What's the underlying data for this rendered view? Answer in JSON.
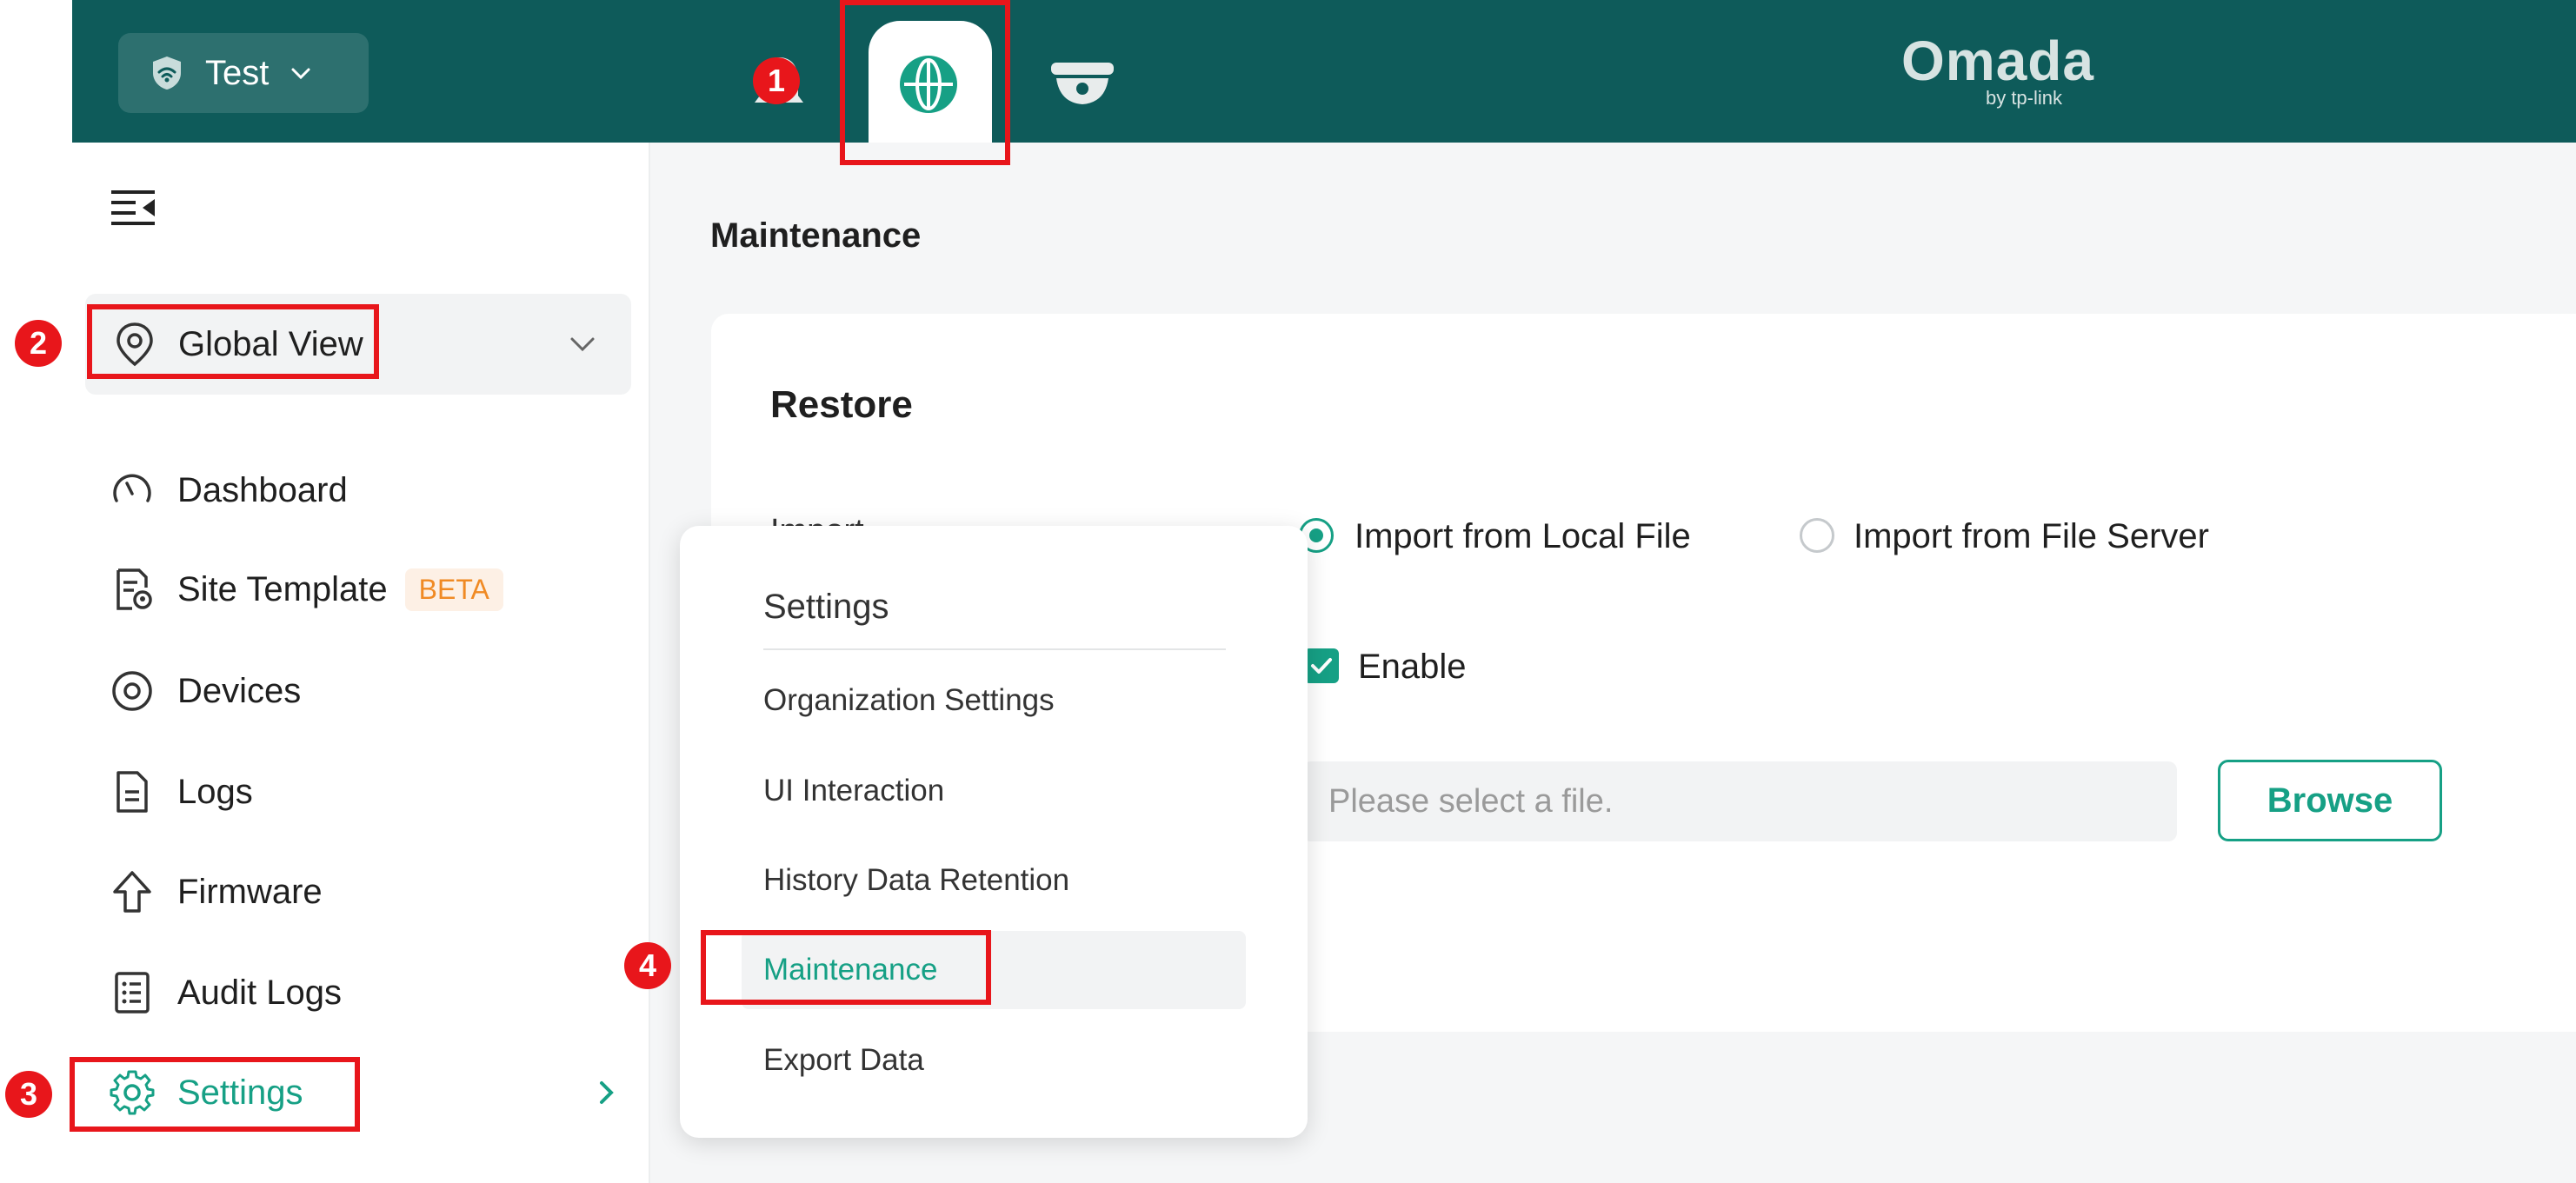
{
  "topbar": {
    "site_name": "Test",
    "logo_text": "Omada",
    "logo_sub": "by tp-link"
  },
  "sidebar": {
    "global_view": "Global View",
    "items": [
      {
        "label": "Dashboard",
        "icon": "dashboard-icon"
      },
      {
        "label": "Site Template",
        "icon": "site-template-icon",
        "badge": "BETA"
      },
      {
        "label": "Devices",
        "icon": "devices-icon"
      },
      {
        "label": "Logs",
        "icon": "logs-icon"
      },
      {
        "label": "Firmware",
        "icon": "firmware-icon"
      },
      {
        "label": "Audit Logs",
        "icon": "audit-logs-icon"
      },
      {
        "label": "Settings",
        "icon": "gear-icon"
      }
    ]
  },
  "main": {
    "page_title": "Maintenance",
    "card_title": "Restore",
    "import_label": "Import",
    "radio_local": "Import from Local File",
    "radio_server": "Import from File Server",
    "enable_label": "Enable",
    "file_placeholder": "Please select a file.",
    "browse_label": "Browse"
  },
  "menu": {
    "title": "Settings",
    "items": [
      "Organization Settings",
      "UI Interaction",
      "History Data Retention",
      "Maintenance",
      "Export Data"
    ]
  },
  "annotations": [
    "1",
    "2",
    "3",
    "4"
  ],
  "colors": {
    "topbar": "#0e5b5a",
    "accent": "#16a085",
    "annotation": "#e8161b",
    "beta": "#f08a24"
  }
}
